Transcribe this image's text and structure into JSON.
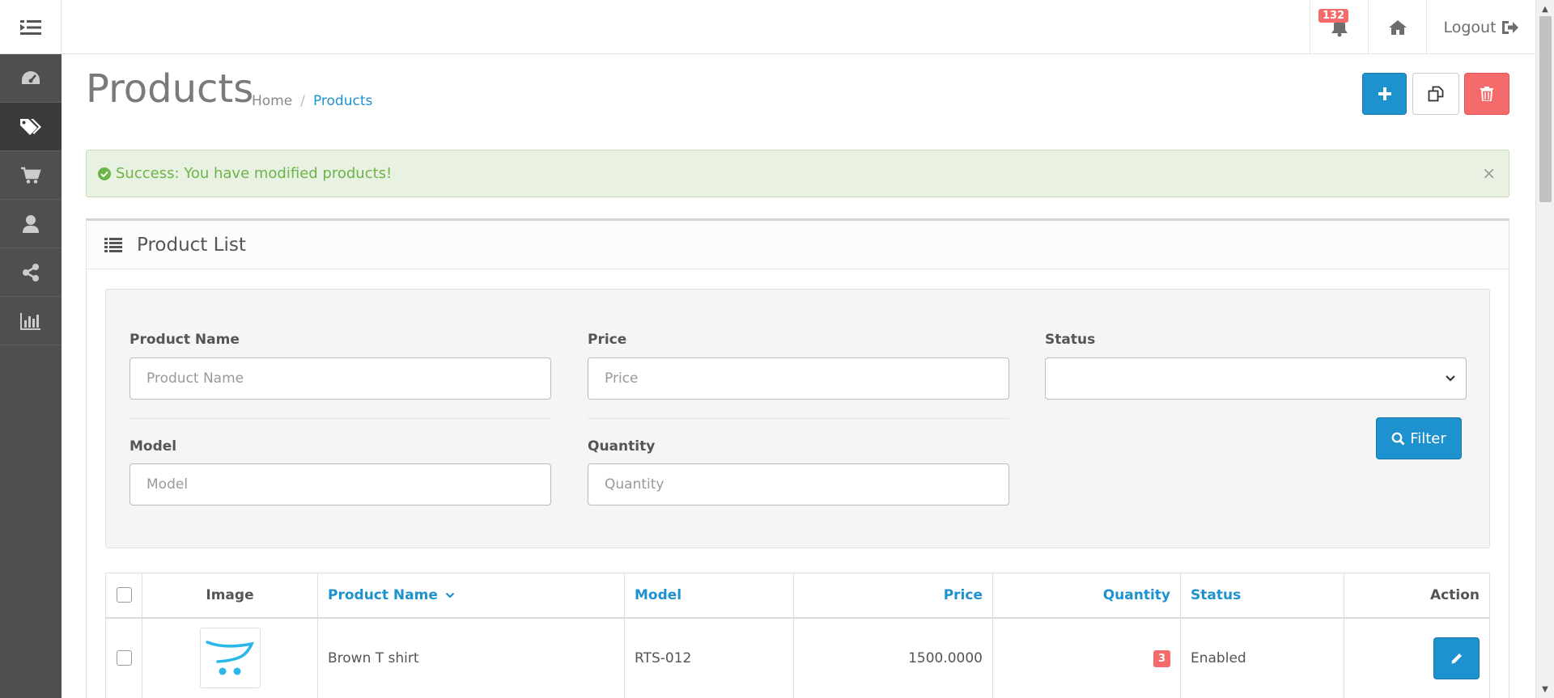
{
  "header": {
    "notification_count": "132",
    "logout_label": "Logout"
  },
  "page": {
    "title": "Products",
    "breadcrumb": {
      "home": "Home",
      "separator": "/",
      "current": "Products"
    }
  },
  "alert": {
    "message": "Success: You have modified products!",
    "close": "×"
  },
  "panel": {
    "title": "Product List"
  },
  "filter": {
    "product_name_label": "Product Name",
    "product_name_placeholder": "Product Name",
    "price_label": "Price",
    "price_placeholder": "Price",
    "status_label": "Status",
    "model_label": "Model",
    "model_placeholder": "Model",
    "quantity_label": "Quantity",
    "quantity_placeholder": "Quantity",
    "filter_button": "Filter"
  },
  "table": {
    "columns": {
      "image": "Image",
      "product_name": "Product Name",
      "model": "Model",
      "price": "Price",
      "quantity": "Quantity",
      "status": "Status",
      "action": "Action"
    },
    "rows": [
      {
        "name": "Brown T shirt",
        "model": "RTS-012",
        "price": "1500.0000",
        "quantity": "3",
        "status": "Enabled"
      }
    ]
  },
  "colors": {
    "primary": "#1e91cf",
    "danger": "#f56b6b",
    "success_text": "#6bb447",
    "sidebar": "#4f4f4f"
  },
  "icons": {
    "menu": "menu-indent-icon",
    "notifications": "bell-icon",
    "home": "home-icon",
    "logout": "sign-out-icon",
    "sidebar": [
      "dashboard-icon",
      "tags-icon",
      "cart-icon",
      "user-icon",
      "share-icon",
      "bar-chart-icon"
    ]
  }
}
